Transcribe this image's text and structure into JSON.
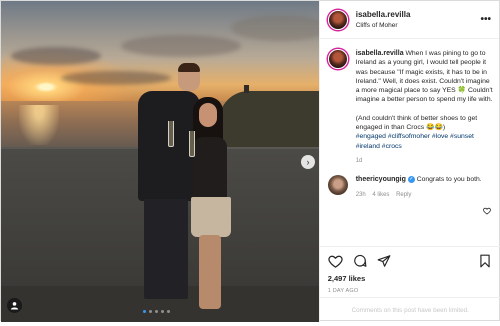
{
  "post": {
    "username": "isabella.revilla",
    "location": "Cliffs of Moher",
    "more_label": "•••"
  },
  "caption": {
    "username": "isabella.revilla",
    "text": "When I was pining to go to Ireland as a young girl, I would tell people it was because \"If magic exists, it has to be in Ireland.\" Well, it does exist. Couldn't imagine a more magical place to say YES 🍀 Couldn't imagine a better person to spend my life with.",
    "text2": "(And couldn't think of better shoes to get engaged in than Crocs 😂😂)",
    "hashtags": "#engaged #cliffsofmoher #love #sunset #ireland #crocs",
    "age": "1d"
  },
  "comment": {
    "username": "theericyoungig",
    "verified_mark": "✓",
    "text": "Congrats to you both.",
    "age": "23h",
    "likes": "4 likes",
    "reply": "Reply"
  },
  "actions": {
    "likes_count": "2,497 likes",
    "date": "1 DAY AGO"
  },
  "footer": {
    "limited_text": "Comments on this post have been limited."
  },
  "carousel": {
    "next_label": "›",
    "total": 5,
    "active": 1
  },
  "icons": {
    "heart": "heart-icon",
    "comment": "comment-icon",
    "share": "share-icon",
    "bookmark": "bookmark-icon",
    "tag": "user-tag-icon",
    "next": "chevron-right-icon",
    "more": "more-options-icon"
  },
  "colors": {
    "link": "#003569",
    "verified": "#3897f0",
    "muted": "#8e8e8e"
  }
}
